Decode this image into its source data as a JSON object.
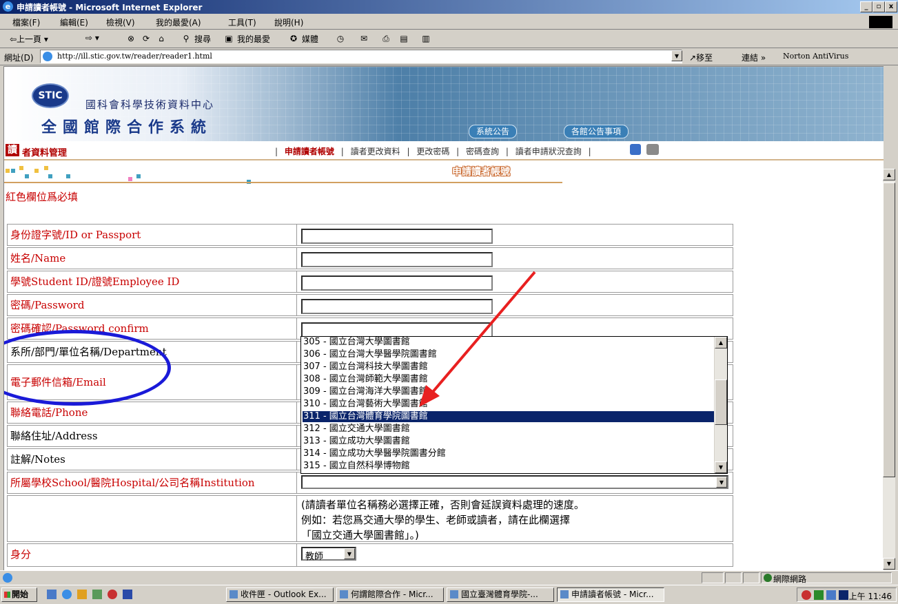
{
  "window": {
    "title": "申請讀者帳號 - Microsoft Internet Explorer",
    "min": "_",
    "max": "▫",
    "close": "x"
  },
  "menu": [
    "檔案(F)",
    "編輯(E)",
    "檢視(V)",
    "我的最愛(A)",
    "工具(T)",
    "說明(H)"
  ],
  "toolbar": {
    "back": "⇦上一頁 ▾",
    "forward": "⇨ ▾",
    "search": "搜尋",
    "favorites": "我的最愛",
    "media": "媒體"
  },
  "address": {
    "label": "網址(D)",
    "url": "http://ill.stic.gov.tw/reader/reader1.html",
    "go": "移至",
    "links": "連結 »",
    "norton": "Norton AntiVirus"
  },
  "banner": {
    "logo": "STIC",
    "org": "國科會科學技術資料中心",
    "system": "全國館際合作系統",
    "btn_announce": "系統公告",
    "btn_library": "各館公告事項"
  },
  "subnav": {
    "badge": "讀",
    "title": "者資料管理",
    "links": [
      "申請讀者帳號",
      "讀者更改資料",
      "更改密碼",
      "密碼查詢",
      "讀者申請狀況查詢"
    ],
    "sep": "|"
  },
  "section_title": "申請讀者帳號",
  "required_note": "紅色欄位爲必填",
  "form": [
    {
      "label": "身份證字號/ID or Passport",
      "required": true
    },
    {
      "label": "姓名/Name",
      "required": true
    },
    {
      "label": "學號Student ID/證號Employee ID",
      "required": true
    },
    {
      "label": "密碼/Password",
      "required": true
    },
    {
      "label": "密碼確認/Password confirm",
      "required": true
    },
    {
      "label": "系所/部門/單位名稱/Department",
      "required": false
    },
    {
      "label": "電子郵件信箱/Email",
      "required": true
    },
    {
      "label": "聯絡電話/Phone",
      "required": true
    },
    {
      "label": "聯絡住址/Address",
      "required": false
    },
    {
      "label": "註解/Notes",
      "required": false
    },
    {
      "label": "所屬學校School/醫院Hospital/公司名稱Institution",
      "required": true
    },
    {
      "label": "",
      "required": false
    },
    {
      "label": "身分",
      "required": true
    }
  ],
  "help_text": [
    "(請讀者單位名稱務必選擇正確，否則會延誤資料處理的速度。",
    "例如：若您爲交通大學的學生、老師或讀者，請在此欄選擇",
    "「國立交通大學圖書館」。)"
  ],
  "identity_select": "教師",
  "institution_options": [
    "305 - 國立台灣大學圖書館",
    "306 - 國立台灣大學醫學院圖書館",
    "307 - 國立台灣科技大學圖書館",
    "308 - 國立台灣師範大學圖書館",
    "309 - 國立台灣海洋大學圖書館",
    "310 - 國立台灣藝術大學圖書館",
    "311 - 國立台灣體育學院圖書館",
    "312 - 國立交通大學圖書館",
    "313 - 國立成功大學圖書館",
    "314 - 國立成功大學醫學院圖書分館",
    "315 - 國立自然科學博物館"
  ],
  "selected_index": 6,
  "status": {
    "zone": "網際網路"
  },
  "taskbar": {
    "start": "開始",
    "tasks": [
      "收件匣 - Outlook Ex...",
      "何謂館際合作 - Micr...",
      "國立臺灣體育學院-...",
      "申請讀者帳號 - Micr..."
    ],
    "clock": "上午 11:46"
  }
}
